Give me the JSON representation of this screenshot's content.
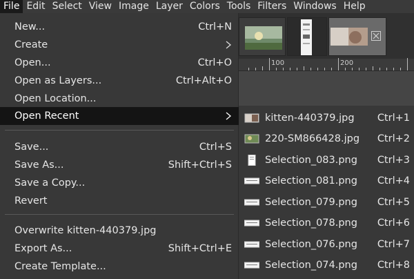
{
  "menubar": {
    "items": [
      {
        "label": "File",
        "active": true
      },
      {
        "label": "Edit"
      },
      {
        "label": "Select"
      },
      {
        "label": "View"
      },
      {
        "label": "Image"
      },
      {
        "label": "Layer"
      },
      {
        "label": "Colors"
      },
      {
        "label": "Tools"
      },
      {
        "label": "Filters"
      },
      {
        "label": "Windows"
      },
      {
        "label": "Help"
      }
    ]
  },
  "file_menu": {
    "items": [
      {
        "label": "New...",
        "accel": "Ctrl+N"
      },
      {
        "label": "Create",
        "submenu": true
      },
      {
        "label": "Open...",
        "accel": "Ctrl+O"
      },
      {
        "label": "Open as Layers...",
        "accel": "Ctrl+Alt+O"
      },
      {
        "label": "Open Location..."
      },
      {
        "label": "Open Recent",
        "submenu": true,
        "highlight": true
      },
      {
        "label": "Save...",
        "accel": "Ctrl+S"
      },
      {
        "label": "Save As...",
        "accel": "Shift+Ctrl+S"
      },
      {
        "label": "Save a Copy..."
      },
      {
        "label": "Revert"
      },
      {
        "label": "Overwrite kitten-440379.jpg"
      },
      {
        "label": "Export As...",
        "accel": "Shift+Ctrl+E"
      },
      {
        "label": "Create Template..."
      }
    ]
  },
  "open_recent": {
    "items": [
      {
        "label": "kitten-440379.jpg",
        "accel": "Ctrl+1",
        "icon": "kitten-thumbnail-icon"
      },
      {
        "label": "220-SM866428.jpg",
        "accel": "Ctrl+2",
        "icon": "landscape-thumbnail-icon"
      },
      {
        "label": "Selection_083.png",
        "accel": "Ctrl+3",
        "icon": "portrait-thumbnail-icon"
      },
      {
        "label": "Selection_081.png",
        "accel": "Ctrl+4",
        "icon": "wide-thumbnail-icon"
      },
      {
        "label": "Selection_079.png",
        "accel": "Ctrl+5",
        "icon": "wide-thumbnail-icon"
      },
      {
        "label": "Selection_078.png",
        "accel": "Ctrl+6",
        "icon": "wide-thumbnail-icon"
      },
      {
        "label": "Selection_076.png",
        "accel": "Ctrl+7",
        "icon": "wide-thumbnail-icon"
      },
      {
        "label": "Selection_074.png",
        "accel": "Ctrl+8",
        "icon": "wide-thumbnail-icon"
      }
    ]
  },
  "ruler": {
    "labels": [
      "100",
      "200"
    ]
  },
  "colors": {
    "menu_bg": "#383838",
    "highlight_bg": "#141414",
    "menubar_bg": "#3a3a3a"
  }
}
